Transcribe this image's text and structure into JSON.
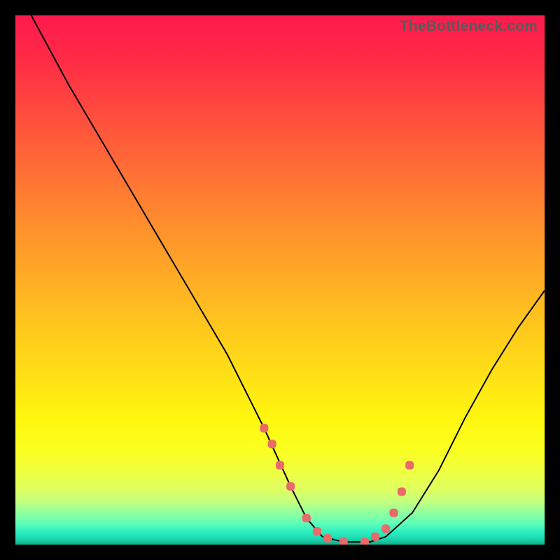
{
  "watermark": "TheBottleneck.com",
  "chart_data": {
    "type": "line",
    "title": "",
    "xlabel": "",
    "ylabel": "",
    "xlim": [
      0,
      100
    ],
    "ylim": [
      0,
      100
    ],
    "series": [
      {
        "name": "bottleneck-curve",
        "x": [
          3,
          10,
          20,
          30,
          40,
          47,
          52,
          55,
          58,
          62,
          67,
          70,
          75,
          80,
          85,
          90,
          95,
          100
        ],
        "values": [
          100,
          87,
          70,
          53,
          36,
          22,
          11,
          5,
          1.5,
          0.5,
          0.5,
          1.5,
          6,
          14,
          24,
          33,
          41,
          48
        ]
      }
    ],
    "markers": {
      "name": "highlight-dots",
      "x": [
        47,
        48.5,
        50,
        52,
        55,
        57,
        59,
        62,
        66,
        68,
        70,
        71.5,
        73,
        74.5
      ],
      "values": [
        22,
        19,
        15,
        11,
        5,
        2.5,
        1.2,
        0.5,
        0.5,
        1.5,
        3,
        6,
        10,
        15
      ]
    },
    "gradient_stops": [
      {
        "pos": 0,
        "color": "#ff1a4d"
      },
      {
        "pos": 50,
        "color": "#ffa726"
      },
      {
        "pos": 82,
        "color": "#fbff20"
      },
      {
        "pos": 100,
        "color": "#10b090"
      }
    ]
  }
}
